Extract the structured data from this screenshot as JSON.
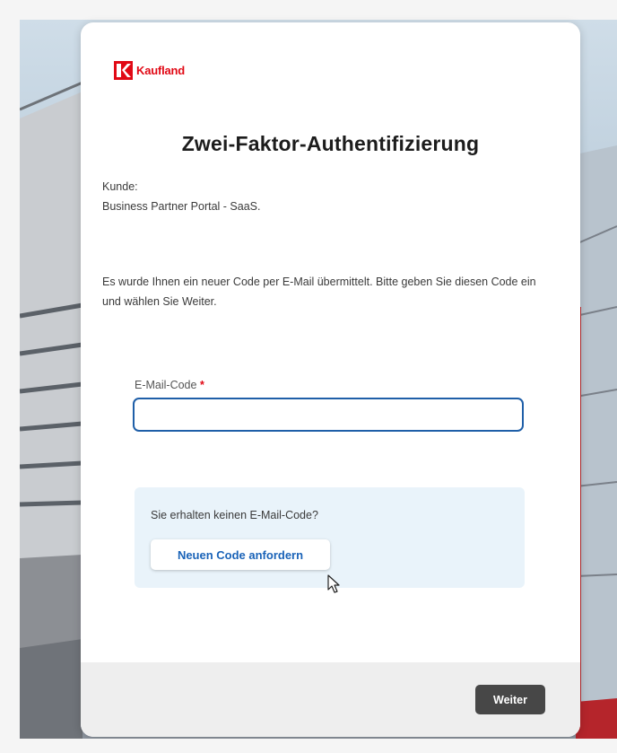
{
  "brand": {
    "name": "Kaufland",
    "accent_color": "#e10915",
    "icon": "kaufland-logo-icon"
  },
  "page": {
    "title": "Zwei-Faktor-Authentifizierung",
    "customer_label": "Kunde:",
    "customer_value": "Business Partner Portal - SaaS.",
    "info_text": "Es wurde Ihnen ein neuer Code per E-Mail übermittelt. Bitte geben Sie diesen Code ein und wählen Sie Weiter."
  },
  "code_field": {
    "label": "E-Mail-Code",
    "required_marker": "*",
    "value": "",
    "border_color": "#1f5fa8"
  },
  "resend": {
    "question": "Sie erhalten keinen E-Mail-Code?",
    "button_label": "Neuen Code anfordern",
    "button_color": "#1a63b8",
    "background": "#e9f3fa"
  },
  "footer": {
    "next_label": "Weiter",
    "next_color": "#474747"
  },
  "cursor": {
    "icon": "mouse-pointer-icon"
  }
}
